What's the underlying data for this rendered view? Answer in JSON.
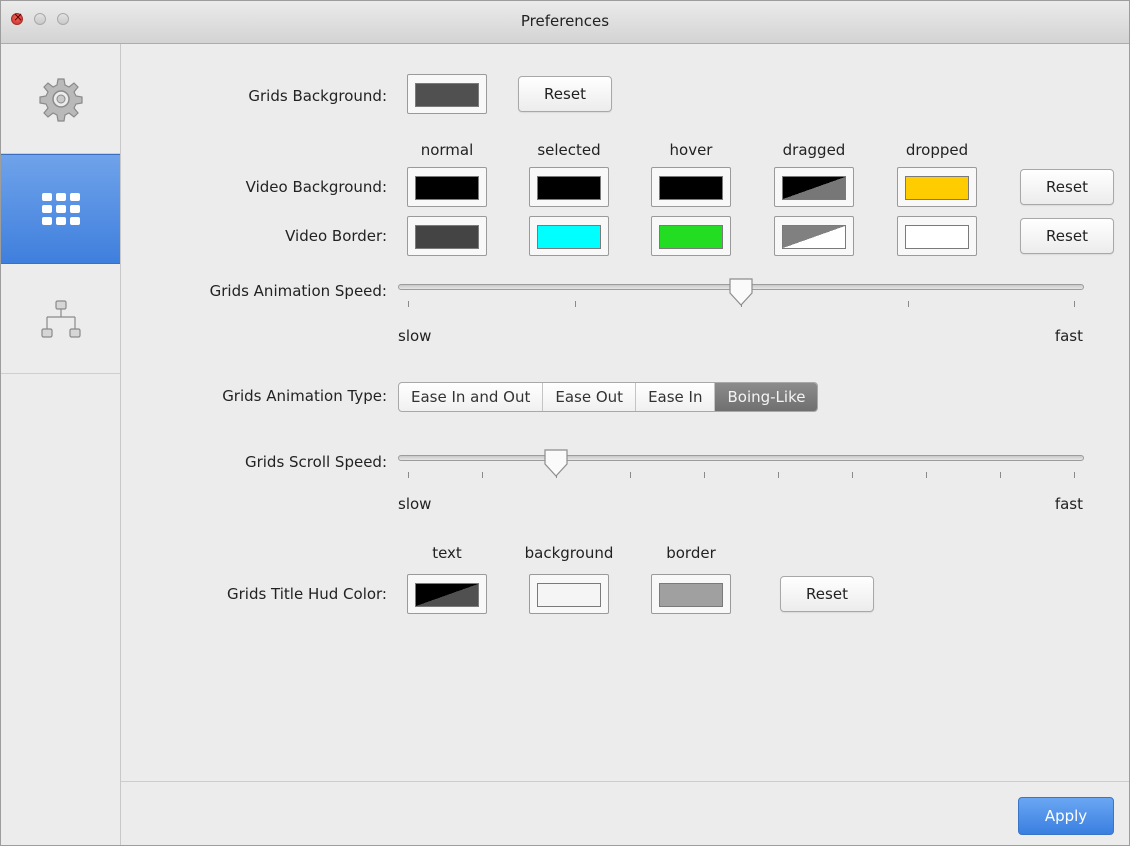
{
  "window": {
    "title": "Preferences"
  },
  "sidebar": {
    "items": [
      {
        "name": "general",
        "icon": "gear-icon",
        "selected": false
      },
      {
        "name": "grids",
        "icon": "grid-icon",
        "selected": true
      },
      {
        "name": "hierarchy",
        "icon": "hierarchy-icon",
        "selected": false
      }
    ]
  },
  "grids_background": {
    "label": "Grids Background:",
    "color": "#505050",
    "reset_label": "Reset"
  },
  "video": {
    "columns": [
      "normal",
      "selected",
      "hover",
      "dragged",
      "dropped"
    ],
    "background": {
      "label": "Video Background:",
      "colors": [
        "#000000",
        "#000000",
        "#000000",
        "#000000/#777777",
        "#ffcc00"
      ],
      "reset_label": "Reset"
    },
    "border": {
      "label": "Video Border:",
      "colors": [
        "#444444",
        "#00ffff",
        "#22dd22",
        "#808080/#ffffff",
        "#ffffff"
      ],
      "reset_label": "Reset"
    }
  },
  "animation_speed": {
    "label": "Grids Animation Speed:",
    "min_label": "slow",
    "max_label": "fast",
    "value": 0.5,
    "ticks": 5
  },
  "animation_type": {
    "label": "Grids Animation Type:",
    "options": [
      "Ease In and Out",
      "Ease Out",
      "Ease In",
      "Boing-Like"
    ],
    "selected": "Boing-Like"
  },
  "scroll_speed": {
    "label": "Grids Scroll Speed:",
    "min_label": "slow",
    "max_label": "fast",
    "value": 0.2222,
    "ticks": 10
  },
  "title_hud": {
    "label": "Grids Title Hud Color:",
    "columns": [
      "text",
      "background",
      "border"
    ],
    "colors": [
      "#000000/#505050",
      "#f5f5f5",
      "#a0a0a0"
    ],
    "reset_label": "Reset"
  },
  "footer": {
    "apply_label": "Apply"
  }
}
